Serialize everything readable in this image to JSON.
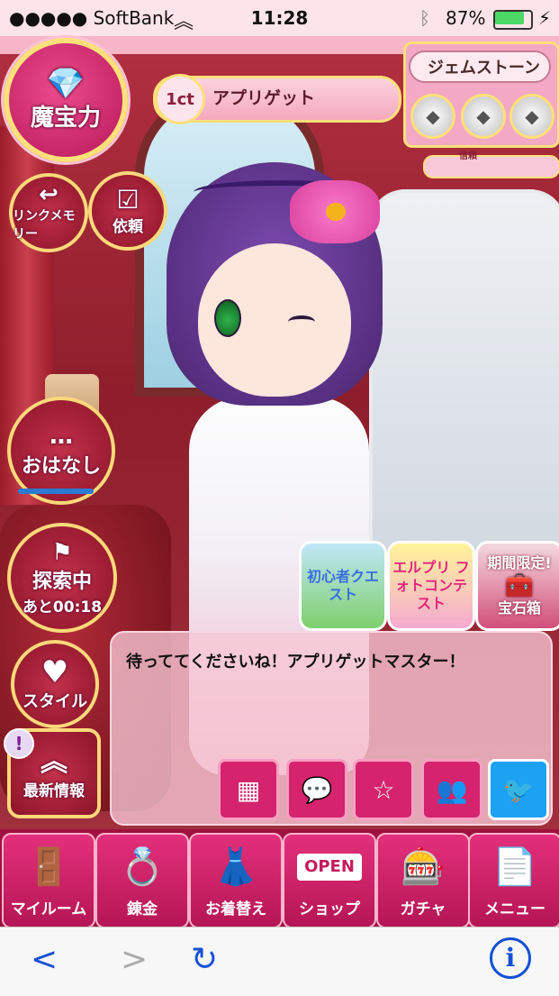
{
  "status_bar": {
    "carrier": "●●●●● SoftBank",
    "wifi_icon": "wifi-icon",
    "time": "11:28",
    "bluetooth_icon": "bluetooth-icon",
    "battery": "87%"
  },
  "hud": {
    "magic_power_label": "魔宝力",
    "carat_badge": "1ct",
    "apprigate_label": "アプリゲット",
    "gemstone_label": "ジェムストーン",
    "trust_label": "信頼",
    "link_memory_label": "リンクメモリー",
    "request_label": "依頼",
    "talk_label": "おはなし",
    "explore_label": "探索中",
    "explore_timer": "あと00:18",
    "style_label": "スタイル",
    "news_label": "最新情報",
    "news_alert": "!"
  },
  "promos": {
    "beginner": "初心者クエスト",
    "photo": "エルプリ フォトコンテスト",
    "limited_top": "期間限定!",
    "limited_bottom": "宝石箱"
  },
  "speech": {
    "text": "待っててくださいね！アプリゲットマスター！"
  },
  "nav": {
    "my_room": "マイルーム",
    "alchemy": "錬金",
    "dress_up": "お着替え",
    "shop": "ショップ",
    "shop_sign": "OPEN",
    "gacha": "ガチャ",
    "menu": "メニュー"
  },
  "browser": {
    "back": "<",
    "forward": ">",
    "reload": "↻",
    "info": "i"
  },
  "colors": {
    "accent_pink": "#d5236d",
    "nav_bg": "#a0113f",
    "gold_border": "#fde07a"
  }
}
